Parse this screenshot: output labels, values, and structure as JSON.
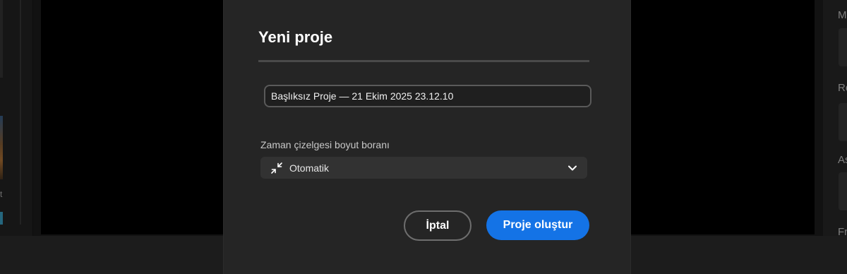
{
  "dialog": {
    "title": "Yeni proje",
    "project_name_value": "Başlıksız Proje — 21 Ekim 2025 23.12.10",
    "timeline_scale_label": "Zaman çizelgesi boyut boranı",
    "timeline_scale_value": "Otomatik",
    "timeline_scale_icon": "collapse-arrows-icon",
    "cancel_label": "İptal",
    "create_label": "Proje oluştur",
    "accent_color": "#1473e6"
  },
  "background": {
    "left_glyph": "t",
    "right_panel_letters": [
      "M",
      "Re",
      "As",
      "Fr"
    ]
  }
}
